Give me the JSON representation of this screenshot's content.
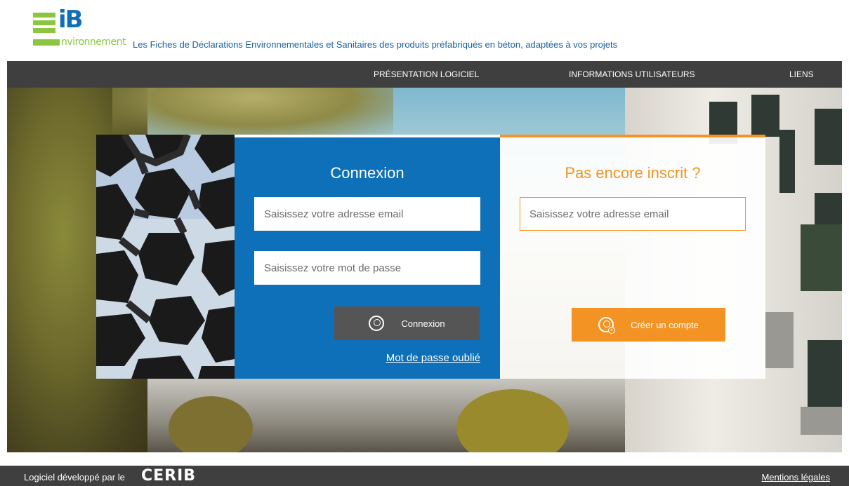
{
  "brand": {
    "logo_letters": "iB",
    "logo_suffix": "nvironnement",
    "tagline": "Les Fiches de Déclarations Environnementales et Sanitaires des produits préfabriqués en béton, adaptées à vos projets"
  },
  "nav": {
    "items": [
      "PRÉSENTATION LOGICIEL",
      "INFORMATIONS UTILISATEURS",
      "LIENS"
    ]
  },
  "login": {
    "title": "Connexion",
    "email_placeholder": "Saisissez votre adresse email",
    "password_placeholder": "Saisissez votre mot de passe",
    "button_label": "Connexion",
    "forgot_link": "Mot de passe oublié"
  },
  "signup": {
    "title": "Pas encore inscrit ?",
    "email_placeholder": "Saisissez votre adresse email",
    "button_label": "Créer un compte"
  },
  "footer": {
    "developed_by": "Logiciel développé par le",
    "cerib_logo": "CERIB",
    "legal_link": "Mentions légales"
  },
  "colors": {
    "primary_blue": "#0d70b8",
    "accent_orange": "#f39323",
    "brand_green": "#8cc63f",
    "nav_dark": "#3f3f3f"
  },
  "icons": [
    "user-icon",
    "add-user-icon"
  ]
}
